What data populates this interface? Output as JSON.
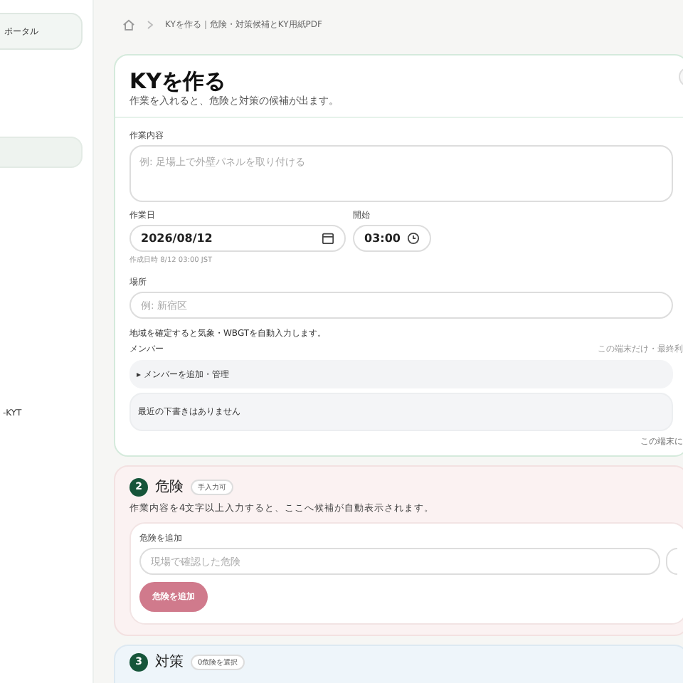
{
  "sidebar": {
    "items": [
      {
        "label": "ポータル",
        "selected": true
      },
      {
        "label": "-KYT",
        "selected": false
      }
    ]
  },
  "breadcrumb": {
    "current": "KYを作る｜危険・対策候補とKY用紙PDF"
  },
  "ky_card": {
    "title": "KYを作る",
    "subtitle": "作業を入れると、危険と対策の候補が出ます。",
    "work_content": {
      "label": "作業内容",
      "placeholder": "例: 足場上で外壁パネルを取り付ける"
    },
    "work_date": {
      "label": "作業日",
      "value": "2026/08/12"
    },
    "start": {
      "label": "開始",
      "value": "03:00"
    },
    "created_at": "作成日時 8/12 03:00 JST",
    "place": {
      "label": "場所",
      "placeholder": "例: 新宿区"
    },
    "place_hint": "地域を確定すると気象・WBGTを自動入力します。",
    "members": {
      "label": "メンバー",
      "note": "この端末だけ・最終利",
      "toggle": "▸ メンバーを追加・管理",
      "expanded": false
    },
    "drafts": {
      "empty": "最近の下書きはありません"
    },
    "footer_note": "この端末に"
  },
  "hazard_card": {
    "step": "2",
    "title": "危険",
    "badge": "手入力可",
    "hint": "作業内容を4文字以上入力すると、ここへ候補が自動表示されます。",
    "add_label": "危険を追加",
    "placeholder": "現場で確認した危険",
    "button": "危険を追加"
  },
  "measure_card": {
    "step": "3",
    "title": "対策",
    "badge": "0危険を選択"
  }
}
